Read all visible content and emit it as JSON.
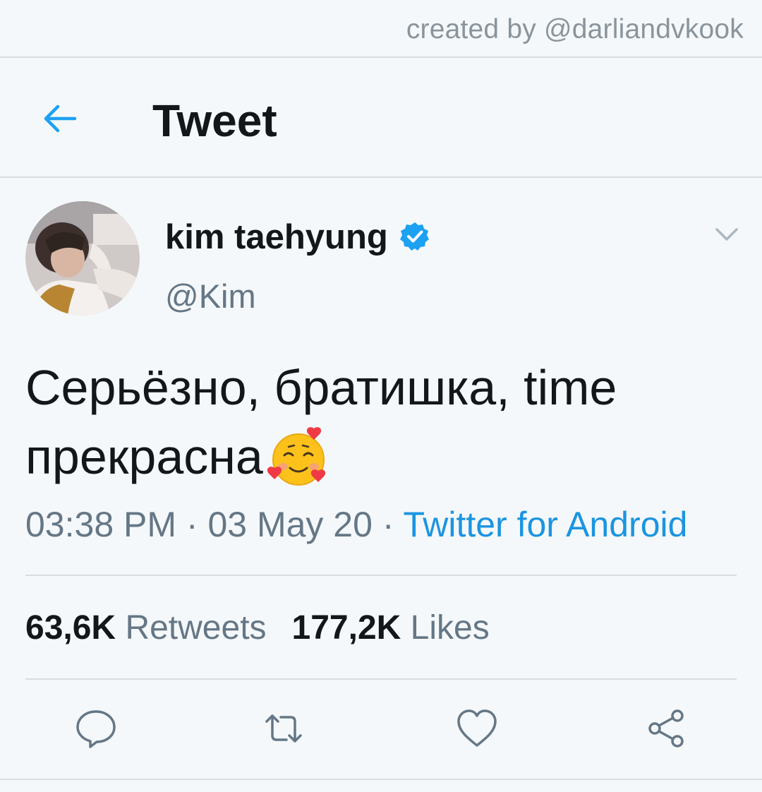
{
  "credit": "created by @darliandvkook",
  "header": {
    "back_icon": "arrow-left-icon",
    "title": "Tweet"
  },
  "author": {
    "display_name": "kim taehyung",
    "handle": "@Kim",
    "verified": true,
    "verified_icon": "verified-badge-icon",
    "menu_icon": "chevron-down-icon"
  },
  "tweet": {
    "line1": "Серьёзно, братишка, time",
    "line2": "прекрасна",
    "emoji": "smiling-face-with-hearts-emoji"
  },
  "meta": {
    "time": "03:38 PM",
    "sep1": " · ",
    "date": "03 May 20",
    "sep2": " · ",
    "source": "Twitter for Android"
  },
  "stats": {
    "retweets_count": "63,6K",
    "retweets_label": "Retweets",
    "likes_count": "177,2K",
    "likes_label": "Likes"
  },
  "actions": [
    {
      "icon": "reply-icon"
    },
    {
      "icon": "retweet-icon"
    },
    {
      "icon": "heart-icon"
    },
    {
      "icon": "share-icon"
    }
  ],
  "colors": {
    "background": "#f5f8fa",
    "text_primary": "#14171a",
    "text_secondary": "#657786",
    "link_blue": "#1b95e0",
    "verified_blue": "#1da1f2",
    "divider": "#d7dde2"
  }
}
